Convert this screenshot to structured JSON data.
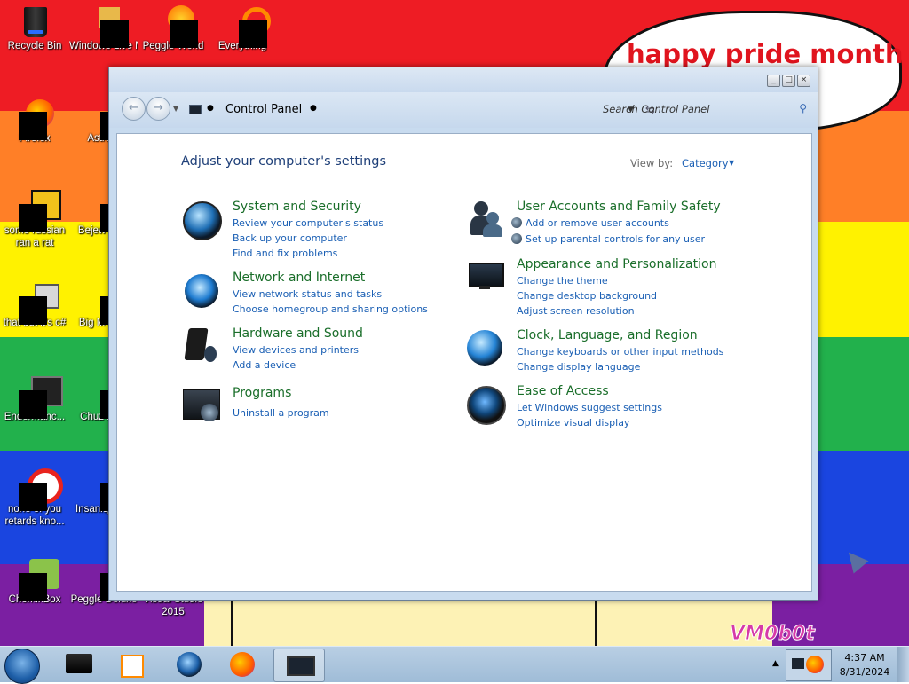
{
  "desktop": {
    "banner_text": "happy pride month",
    "watermark": "VM0b0t",
    "colors": {
      "red": "#ee1c24",
      "orange": "#ff7f27",
      "yellow": "#fff200",
      "green": "#22b14c",
      "blue": "#1a45e0",
      "purple": "#7b1fa2"
    },
    "icons": [
      {
        "label": "Recycle Bin",
        "icon": "recycle-bin-icon"
      },
      {
        "label": "Windows Live Ma",
        "icon": "windows-live-icon"
      },
      {
        "label": "Peggle World",
        "icon": "peggle-world-icon"
      },
      {
        "label": "Everything",
        "icon": "everything-search-icon"
      },
      {
        "label": "Firefox",
        "icon": "firefox-icon"
      },
      {
        "label": "Astro Delu",
        "icon": "game-icon"
      },
      {
        "label": "some russian ran a rat",
        "icon": "exe-icon"
      },
      {
        "label": "Bejew Delu",
        "icon": "bejeweled-icon"
      },
      {
        "label": "that but it's c#",
        "icon": "shortcut-icon"
      },
      {
        "label": "Big M Delu",
        "icon": "game-icon"
      },
      {
        "label": "Endermanc...",
        "icon": "terminal-icon"
      },
      {
        "label": "Chuz Delu",
        "icon": "game-icon"
      },
      {
        "label": "none of you retards kno...",
        "icon": "opera-icon"
      },
      {
        "label": "Insaniq Delu",
        "icon": "game-icon"
      },
      {
        "label": "ChomikBox",
        "icon": "chomikbox-icon"
      },
      {
        "label": "Peggle Deluxe",
        "icon": "peggle-deluxe-icon"
      },
      {
        "label": "Visual Studio 2015",
        "icon": "visual-studio-icon"
      }
    ]
  },
  "window": {
    "address": "Control Panel",
    "search_placeholder": "Search Control Panel",
    "heading": "Adjust your computer's settings",
    "view_by_label": "View by:",
    "view_by_value": "Category",
    "categories": [
      {
        "title": "System and Security",
        "icon": "system-security-icon",
        "links": [
          "Review your computer's status",
          "Back up your computer",
          "Find and fix problems"
        ]
      },
      {
        "title": "Network and Internet",
        "icon": "network-internet-icon",
        "links": [
          "View network status and tasks",
          "Choose homegroup and sharing options"
        ]
      },
      {
        "title": "Hardware and Sound",
        "icon": "hardware-sound-icon",
        "links": [
          "View devices and printers",
          "Add a device"
        ]
      },
      {
        "title": "Programs",
        "icon": "programs-icon",
        "links": [
          "Uninstall a program"
        ]
      },
      {
        "title": "User Accounts and Family Safety",
        "icon": "user-accounts-icon",
        "links": [
          "Add or remove user accounts",
          "Set up parental controls for any user"
        ]
      },
      {
        "title": "Appearance and Personalization",
        "icon": "appearance-icon",
        "links": [
          "Change the theme",
          "Change desktop background",
          "Adjust screen resolution"
        ]
      },
      {
        "title": "Clock, Language, and Region",
        "icon": "clock-language-icon",
        "links": [
          "Change keyboards or other input methods",
          "Change display language"
        ]
      },
      {
        "title": "Ease of Access",
        "icon": "ease-of-access-icon",
        "links": [
          "Let Windows suggest settings",
          "Optimize visual display"
        ]
      }
    ]
  },
  "taskbar": {
    "items": [
      "start-orb",
      "computer-icon",
      "media-player-icon",
      "globe-icon",
      "firefox-icon",
      "control-panel-icon"
    ],
    "time": "4:37 AM",
    "date": "8/31/2024"
  }
}
